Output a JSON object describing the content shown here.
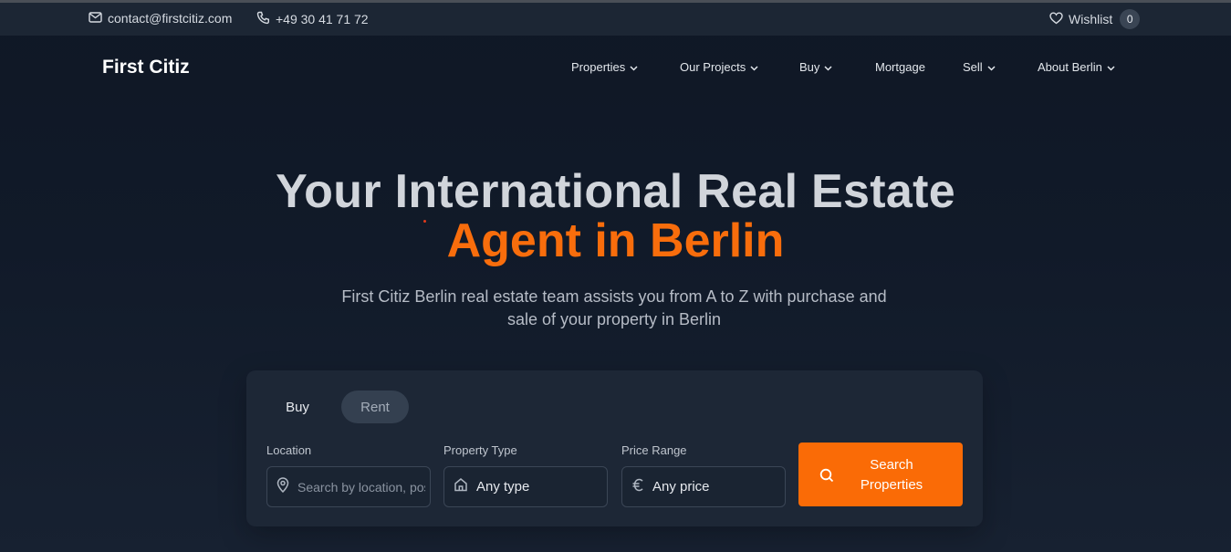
{
  "topbar": {
    "email": "contact@firstcitiz.com",
    "phone": "+49 30 41 71 72",
    "wishlist_label": "Wishlist",
    "wishlist_count": "0"
  },
  "header": {
    "brand": "First Citiz",
    "nav": [
      {
        "label": "Properties",
        "has_dropdown": true
      },
      {
        "label": "Our Projects",
        "has_dropdown": true
      },
      {
        "label": "Buy",
        "has_dropdown": true
      },
      {
        "label": "Mortgage",
        "has_dropdown": false
      },
      {
        "label": "Sell",
        "has_dropdown": true
      },
      {
        "label": "About Berlin",
        "has_dropdown": true
      }
    ]
  },
  "hero": {
    "title_line1": "Your International Real Estate",
    "title_line2": "Agent in Berlin",
    "subtitle": "First Citiz Berlin real estate team assists you from A to Z with purchase and sale of your property in Berlin"
  },
  "search": {
    "tabs": [
      {
        "label": "Buy",
        "active": true
      },
      {
        "label": "Rent",
        "active": false
      }
    ],
    "location": {
      "label": "Location",
      "placeholder": "Search by location, postcode...",
      "icon": "map-pin-icon"
    },
    "property_type": {
      "label": "Property Type",
      "value": "Any type",
      "icon": "home-icon"
    },
    "price_range": {
      "label": "Price Range",
      "value": "Any price",
      "icon": "euro-icon"
    },
    "button_label": "Search Properties"
  },
  "colors": {
    "accent": "#f86d0c",
    "background": "#111827",
    "card": "#1d2736",
    "topbar": "#1c2634"
  }
}
